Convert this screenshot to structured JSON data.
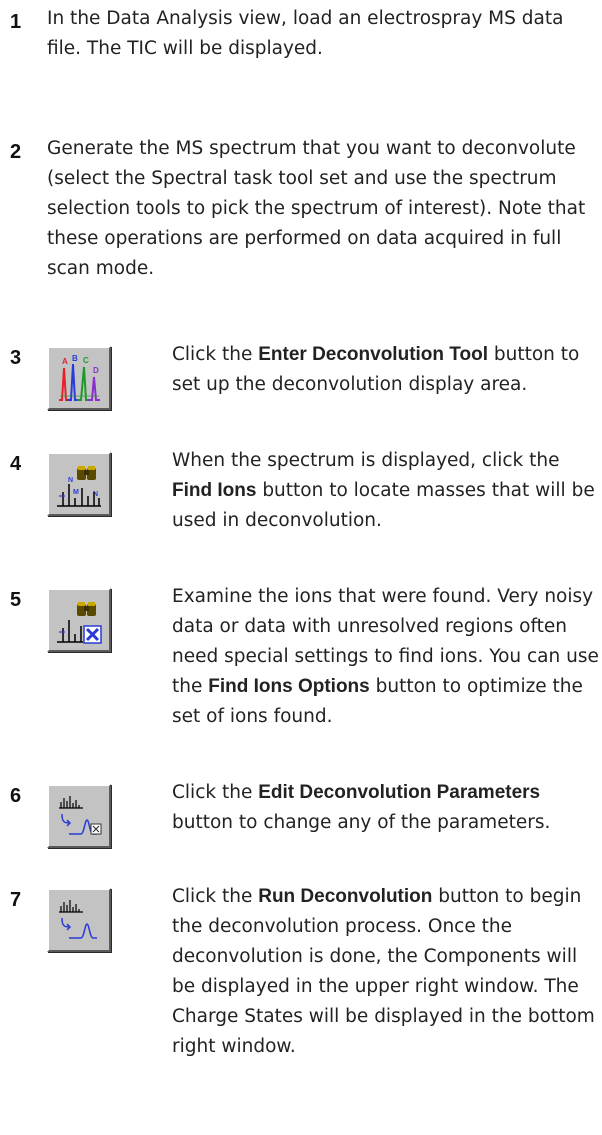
{
  "steps": [
    {
      "number": "1",
      "text": "In the Data Analysis view, load an electrospray MS data file.  The TIC will be displayed."
    },
    {
      "number": "2",
      "text": "Generate the MS spectrum that you want to deconvolute (select the Spectral task tool set and use the spectrum selection tools to pick the spectrum of interest). Note that these operations are performed on data acquired in full scan mode."
    },
    {
      "number": "3",
      "pre": "Click the ",
      "bold": "Enter Deconvolution Tool",
      "post": " button to set up the deconvolution display area.",
      "icon": "enter-deconvolution-tool-icon"
    },
    {
      "number": "4",
      "pre": "When the spectrum is displayed, click the ",
      "bold": "Find Ions",
      "post": " button to locate masses that will be used in deconvolution.",
      "icon": "find-ions-icon"
    },
    {
      "number": "5",
      "pre": "Examine the ions that were found. Very noisy data or data with unresolved regions often need special settings to find ions.  You can use the ",
      "bold": "Find Ions Options",
      "post": " button to optimize the set of ions found.",
      "icon": "find-ions-options-icon"
    },
    {
      "number": "6",
      "pre": "Click the ",
      "bold": "Edit Deconvolution Parameters",
      "post": " button to change any of the parameters.",
      "icon": "edit-deconvolution-parameters-icon"
    },
    {
      "number": "7",
      "pre": "Click the ",
      "bold": "Run Deconvolution",
      "post": " button to begin the deconvolution process. Once the deconvolution is done, the Components will be displayed in the upper right window. The Charge States will be displayed in the bottom right window.",
      "icon": "run-deconvolution-icon"
    }
  ],
  "icon_labels": {
    "peak_letters": [
      "A",
      "B",
      "C",
      "D"
    ],
    "mass_letters": [
      "N",
      "M",
      "N"
    ]
  },
  "colors": {
    "peak_red": "#e8202a",
    "peak_blue": "#2b3bd8",
    "peak_green": "#1f9a2a",
    "peak_purple": "#8a2ed0",
    "button_face": "#c3c3c3"
  }
}
